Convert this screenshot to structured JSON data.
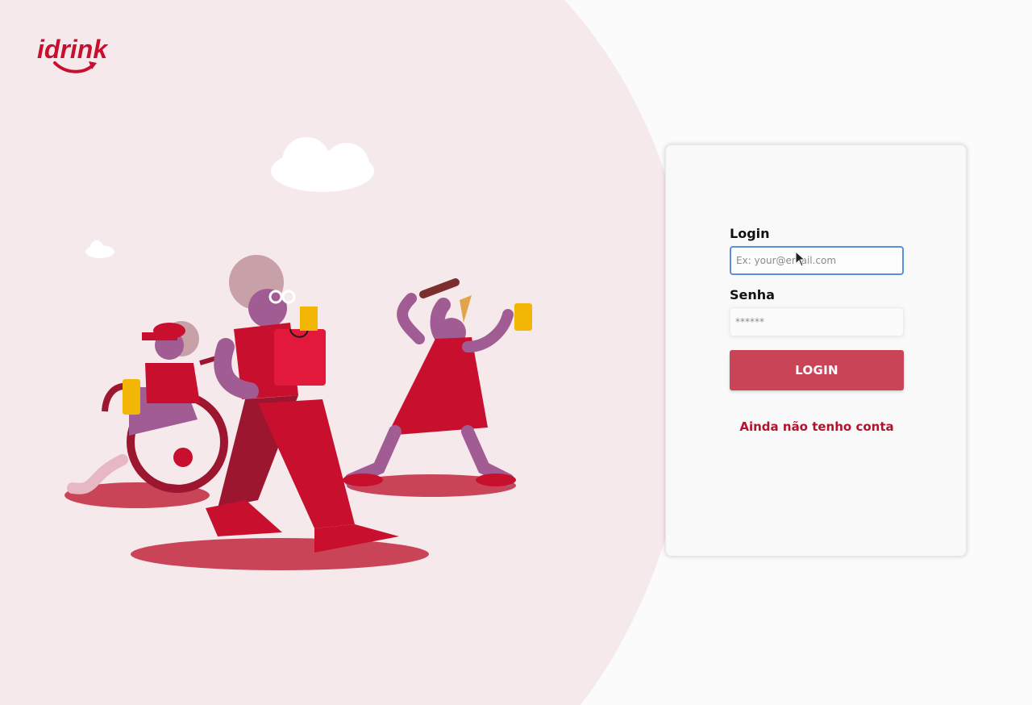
{
  "brand": {
    "logo_text": "idrink",
    "color": "#c8102e"
  },
  "form": {
    "login_label": "Login",
    "login_placeholder": "Ex: your@email.com",
    "login_value": "",
    "password_label": "Senha",
    "password_placeholder": "******",
    "password_value": "",
    "submit_label": "LOGIN",
    "signup_link": "Ainda não tenho conta"
  },
  "colors": {
    "accent": "#c94457",
    "link": "#b3112e",
    "background_blob": "#f6e9ec",
    "focus_border": "#5a8fe0"
  },
  "icons": [
    "idrink-logo",
    "mouse-cursor-icon"
  ]
}
